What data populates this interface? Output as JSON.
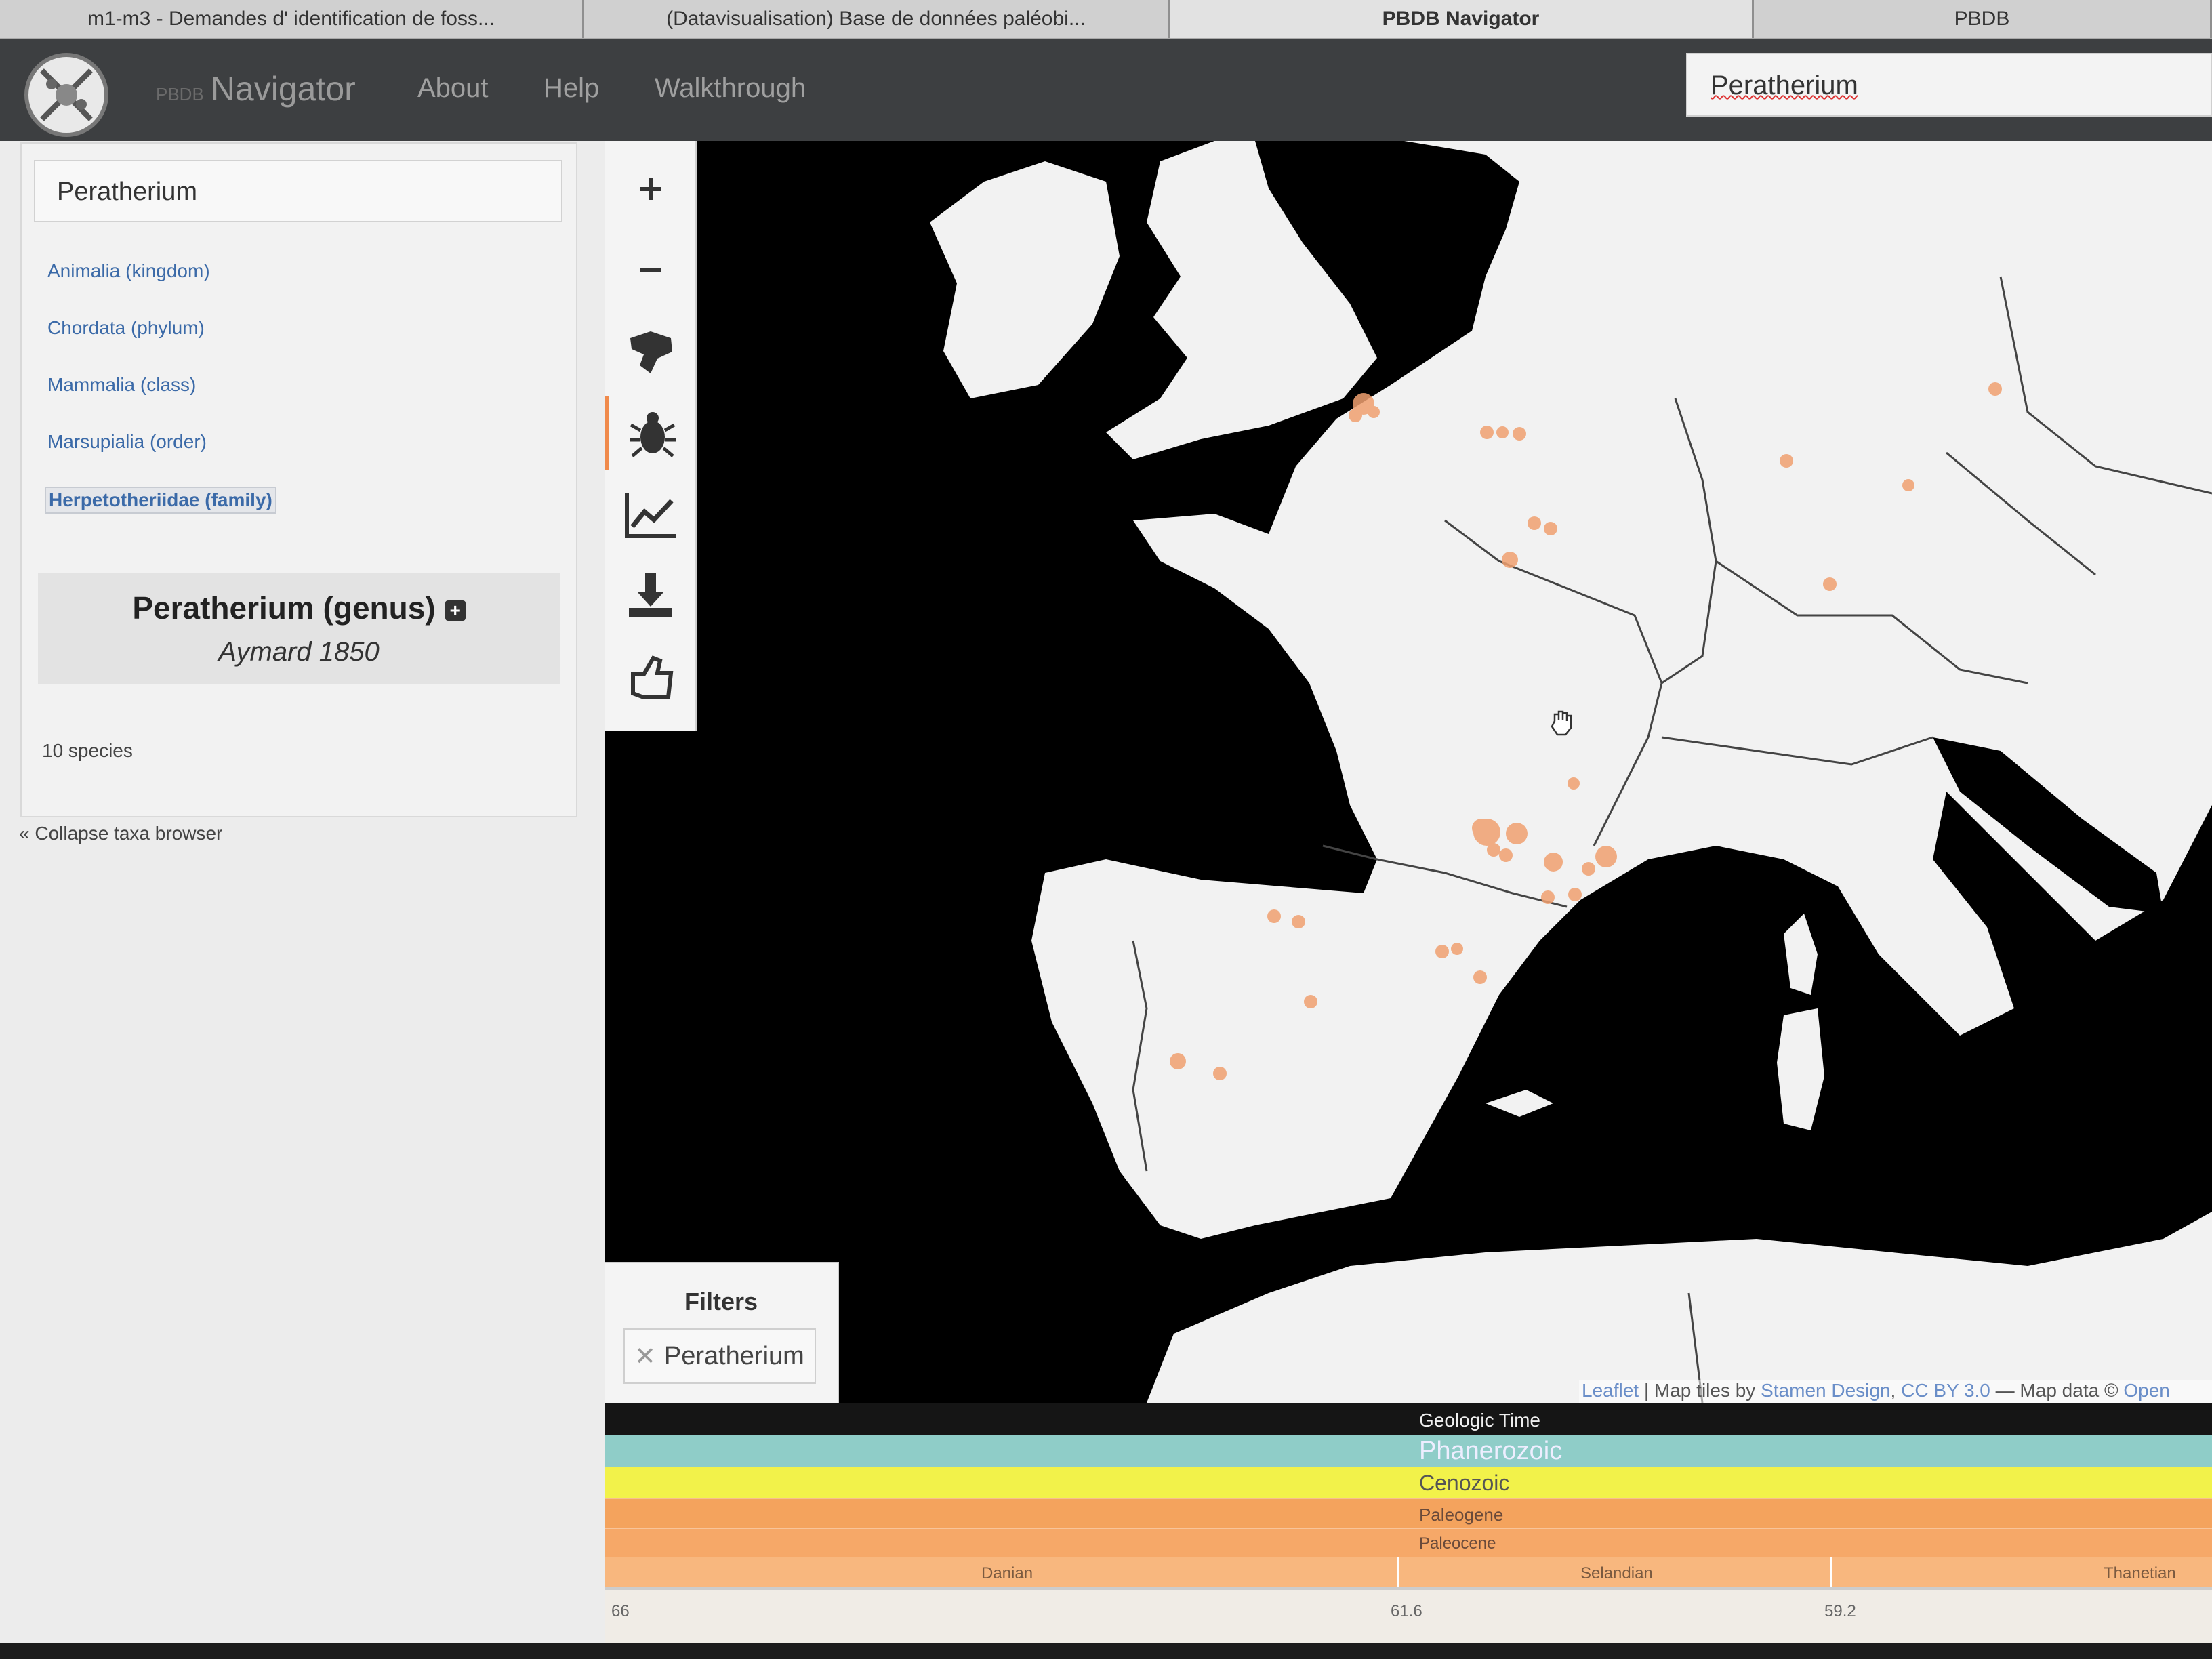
{
  "tabs": [
    "m1-m3 - Demandes d' identification de foss...",
    "(Datavisualisation) Base de données paléobi...",
    "PBDB Navigator",
    "PBDB"
  ],
  "nav": {
    "brand_prefix": "PBDB",
    "brand": "Navigator",
    "links": [
      "About",
      "Help",
      "Walkthrough"
    ],
    "search_value": "Peratherium"
  },
  "taxa": {
    "input_value": "Peratherium",
    "ranks": [
      "Animalia (kingdom)",
      "Chordata (phylum)",
      "Mammalia (class)",
      "Marsupialia (order)",
      "Herpetotheriidae (family)"
    ],
    "genus": "Peratherium (genus)",
    "authority": "Aymard 1850",
    "species_count": "10 species",
    "collapse_label": "« Collapse taxa browser"
  },
  "toolbar": {
    "icons": [
      "zoom-in-icon",
      "zoom-out-icon",
      "continents-icon",
      "taxa-bug-icon",
      "diversity-chart-icon",
      "download-icon",
      "thumbs-up-icon"
    ],
    "active_index": 3
  },
  "filters": {
    "title": "Filters",
    "chip": "Peratherium"
  },
  "attribution": {
    "leaflet": "Leaflet",
    "text1": " | Map tiles by ",
    "stamen": "Stamen Design",
    "text2": ", ",
    "license": "CC BY 3.0",
    "text3": " — Map data © ",
    "osm": "Open"
  },
  "timescale": {
    "title": "Geologic Time",
    "eon": "Phanerozoic",
    "era": "Cenozoic",
    "period": "Paleogene",
    "epoch": "Paleocene",
    "ages": [
      "Danian",
      "Selandian",
      "Thanetian"
    ],
    "ticks": [
      "66",
      "61.6",
      "59.2"
    ]
  },
  "colors": {
    "eon": "#8fcdc8",
    "era": "#f2f24a",
    "period": "#f4a35d",
    "epoch": "#f6a868",
    "age": "#f8b77e",
    "occurrence": "#f0a070"
  }
}
